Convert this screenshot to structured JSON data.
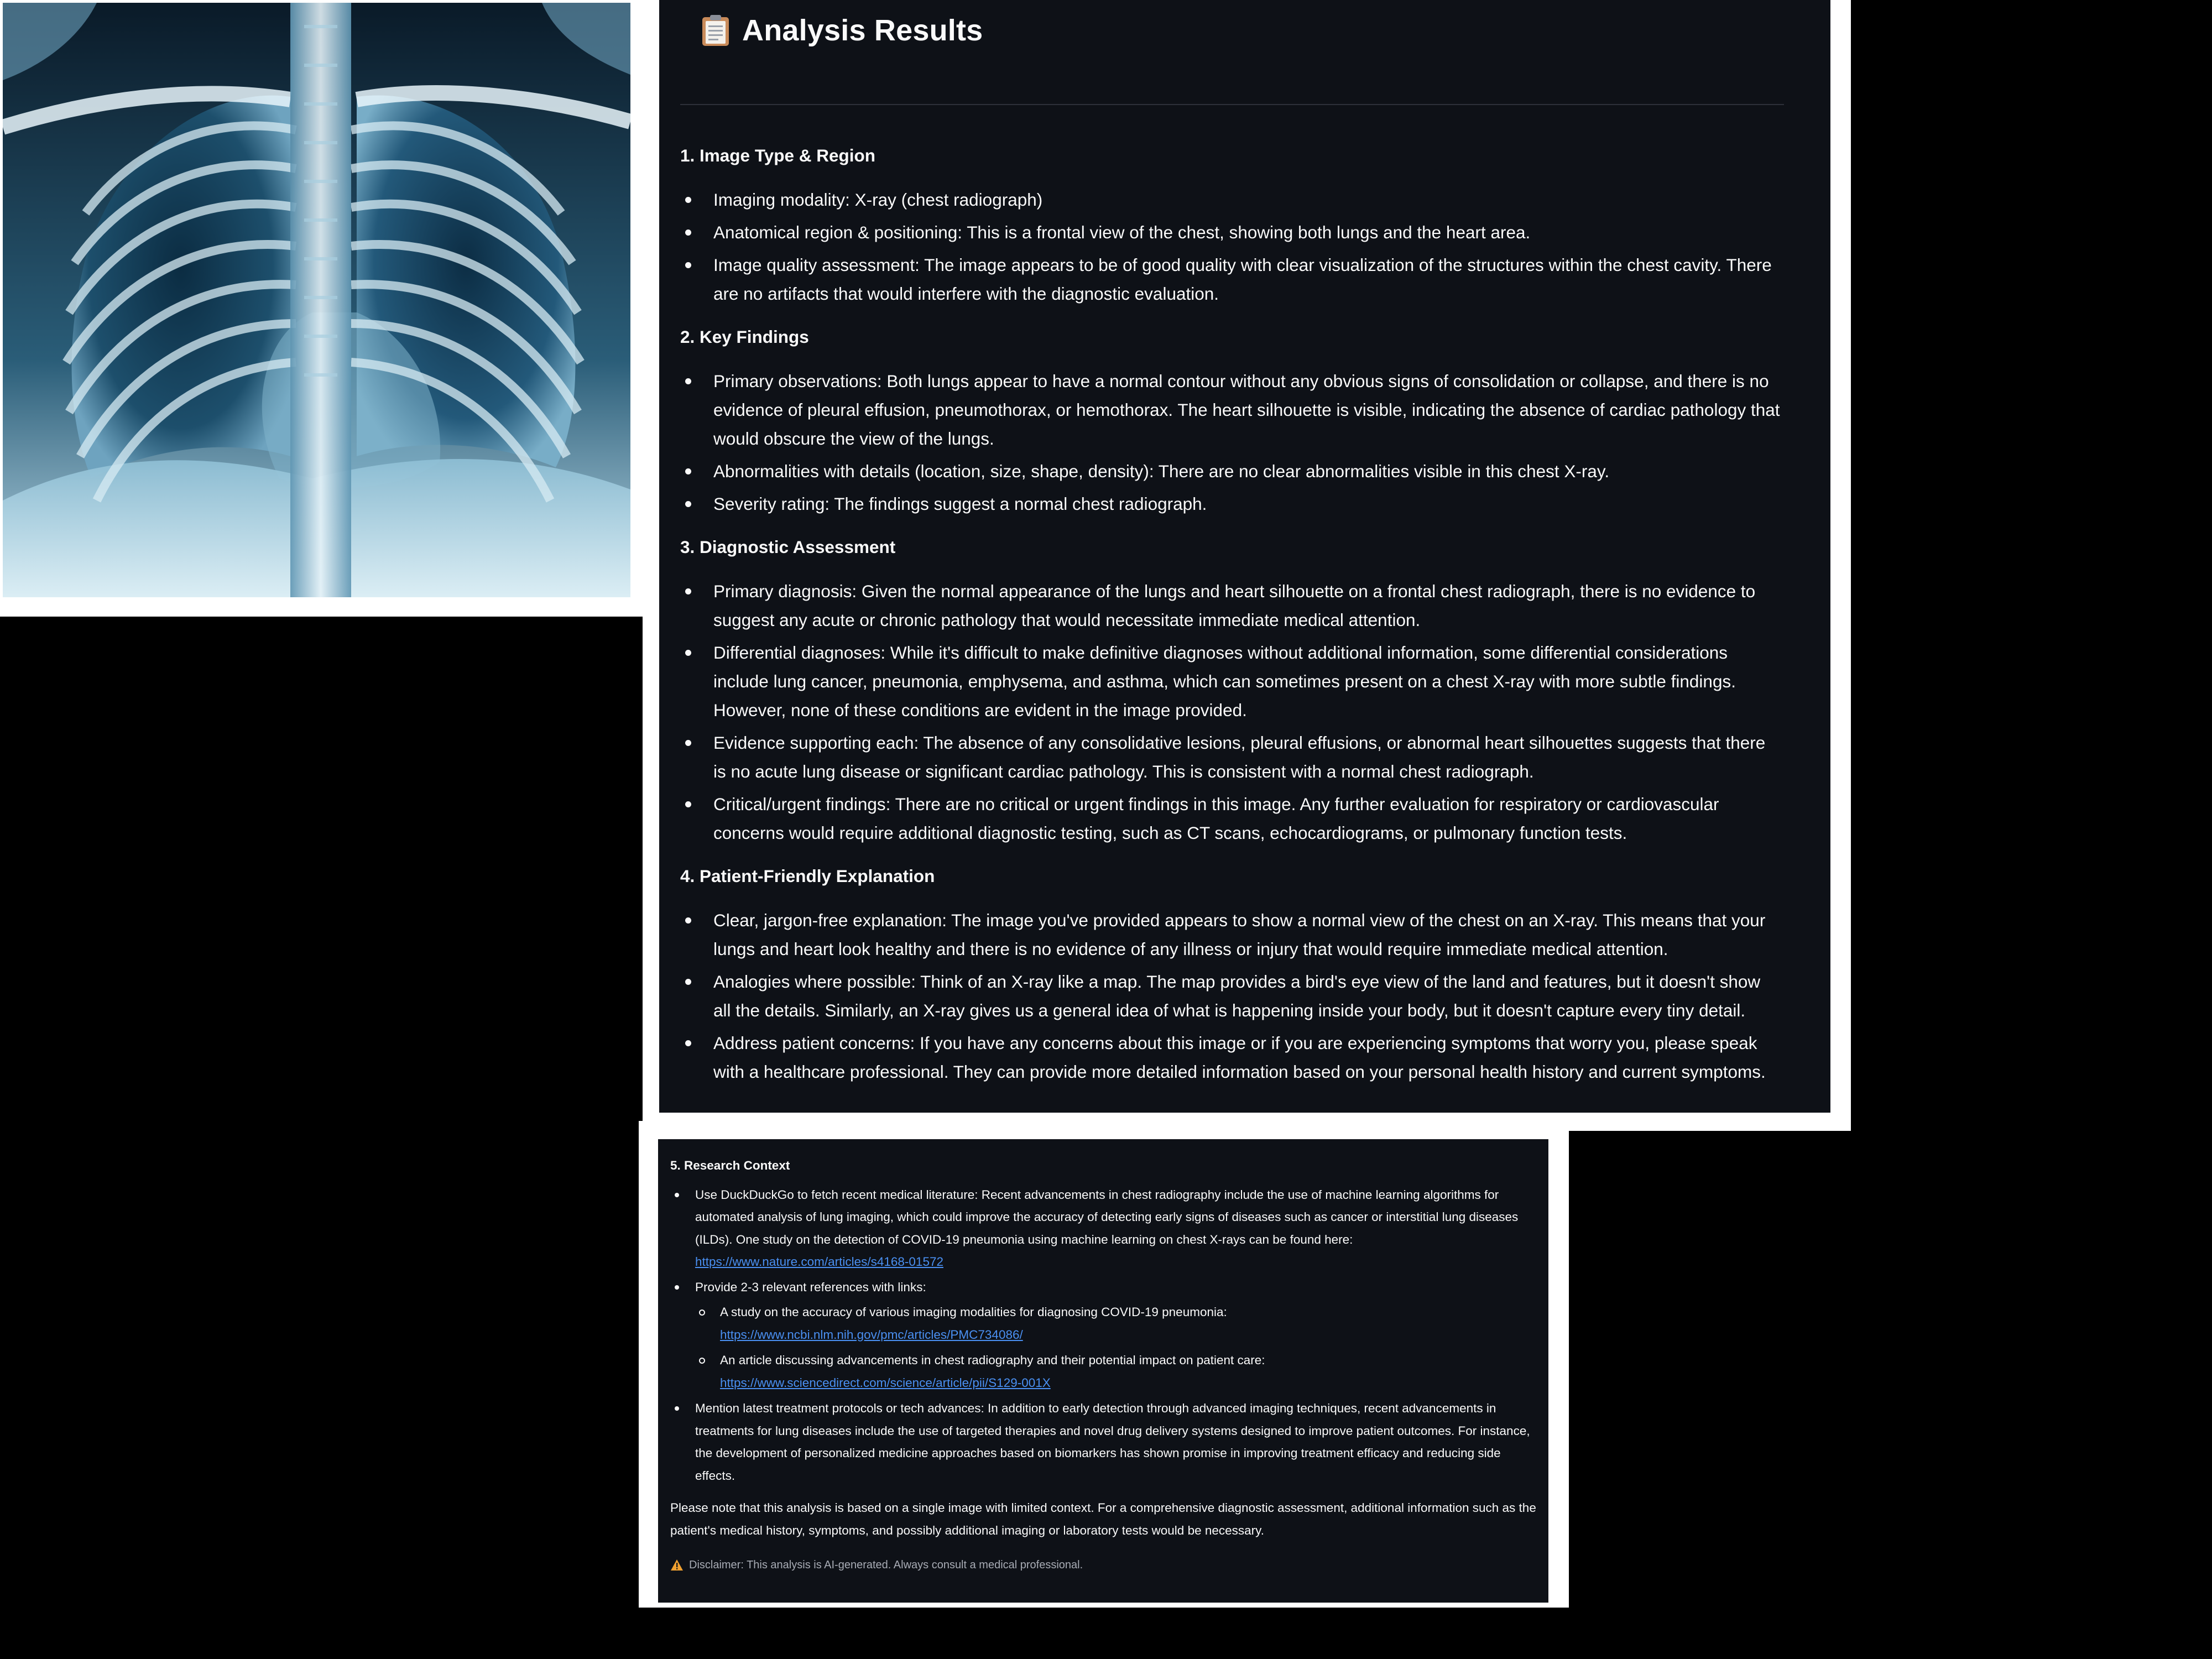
{
  "analysis": {
    "title": "Analysis Results",
    "sections": [
      {
        "heading": "1. Image Type & Region",
        "bullets": [
          "Imaging modality: X-ray (chest radiograph)",
          "Anatomical region & positioning: This is a frontal view of the chest, showing both lungs and the heart area.",
          "Image quality assessment: The image appears to be of good quality with clear visualization of the structures within the chest cavity. There are no artifacts that would interfere with the diagnostic evaluation."
        ]
      },
      {
        "heading": "2. Key Findings",
        "bullets": [
          "Primary observations: Both lungs appear to have a normal contour without any obvious signs of consolidation or collapse, and there is no evidence of pleural effusion, pneumothorax, or hemothorax. The heart silhouette is visible, indicating the absence of cardiac pathology that would obscure the view of the lungs.",
          "Abnormalities with details (location, size, shape, density): There are no clear abnormalities visible in this chest X-ray.",
          "Severity rating: The findings suggest a normal chest radiograph."
        ]
      },
      {
        "heading": "3. Diagnostic Assessment",
        "bullets": [
          "Primary diagnosis: Given the normal appearance of the lungs and heart silhouette on a frontal chest radiograph, there is no evidence to suggest any acute or chronic pathology that would necessitate immediate medical attention.",
          "Differential diagnoses: While it's difficult to make definitive diagnoses without additional information, some differential considerations include lung cancer, pneumonia, emphysema, and asthma, which can sometimes present on a chest X-ray with more subtle findings. However, none of these conditions are evident in the image provided.",
          "Evidence supporting each: The absence of any consolidative lesions, pleural effusions, or abnormal heart silhouettes suggests that there is no acute lung disease or significant cardiac pathology. This is consistent with a normal chest radiograph.",
          "Critical/urgent findings: There are no critical or urgent findings in this image. Any further evaluation for respiratory or cardiovascular concerns would require additional diagnostic testing, such as CT scans, echocardiograms, or pulmonary function tests."
        ]
      },
      {
        "heading": "4. Patient-Friendly Explanation",
        "bullets": [
          "Clear, jargon-free explanation: The image you've provided appears to show a normal view of the chest on an X-ray. This means that your lungs and heart look healthy and there is no evidence of any illness or injury that would require immediate medical attention.",
          "Analogies where possible: Think of an X-ray like a map. The map provides a bird's eye view of the land and features, but it doesn't show all the details. Similarly, an X-ray gives us a general idea of what is happening inside your body, but it doesn't capture every tiny detail.",
          "Address patient concerns: If you have any concerns about this image or if you are experiencing symptoms that worry you, please speak with a healthcare professional. They can provide more detailed information based on your personal health history and current symptoms."
        ]
      }
    ]
  },
  "research": {
    "heading": "5. Research Context",
    "bullet1_text": "Use DuckDuckGo to fetch recent medical literature: Recent advancements in chest radiography include the use of machine learning algorithms for automated analysis of lung imaging, which could improve the accuracy of detecting early signs of diseases such as cancer or interstitial lung diseases (ILDs). One study on the detection of COVID-19 pneumonia using machine learning on chest X-rays can be found here:",
    "bullet1_link": "https://www.nature.com/articles/s4168-01572",
    "bullet2_text": "Provide 2-3 relevant references with links:",
    "references": [
      {
        "text": "A study on the accuracy of various imaging modalities for diagnosing COVID-19 pneumonia:",
        "link": "https://www.ncbi.nlm.nih.gov/pmc/articles/PMC734086/"
      },
      {
        "text": "An article discussing advancements in chest radiography and their potential impact on patient care:",
        "link": "https://www.sciencedirect.com/science/article/pii/S129-001X"
      }
    ],
    "bullet3_text": "Mention latest treatment protocols or tech advances: In addition to early detection through advanced imaging techniques, recent advancements in treatments for lung diseases include the use of targeted therapies and novel drug delivery systems designed to improve patient outcomes. For instance, the development of personalized medicine approaches based on biomarkers has shown promise in improving treatment efficacy and reducing side effects.",
    "note": "Please note that this analysis is based on a single image with limited context. For a comprehensive diagnostic assessment, additional information such as the patient's medical history, symptoms, and possibly additional imaging or laboratory tests would be necessary.",
    "disclaimer": "Disclaimer: This analysis is AI-generated. Always consult a medical professional."
  },
  "icons": {
    "title_icon": "clipboard-icon",
    "disclaimer_icon": "warning-icon"
  },
  "colors": {
    "panel_background": "#0e1117",
    "text": "#fafafa",
    "link": "#4a90f2",
    "warning": "#f0a030"
  }
}
